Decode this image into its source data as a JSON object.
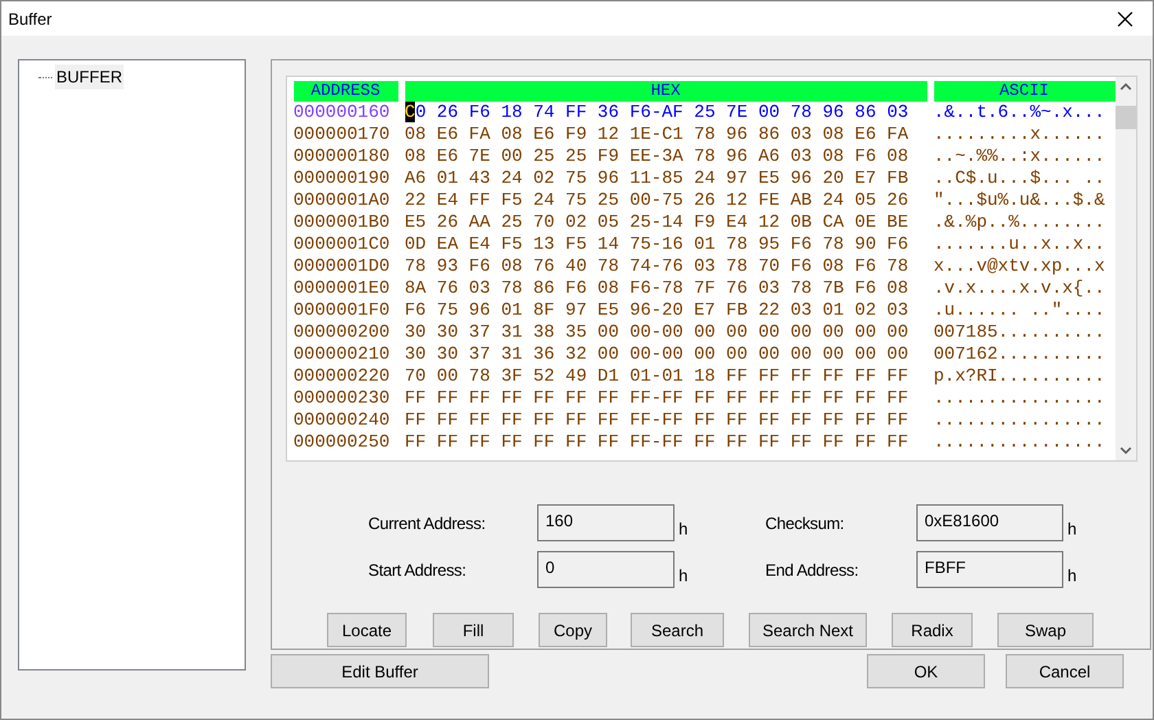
{
  "window": {
    "title": "Buffer"
  },
  "tree": {
    "items": [
      {
        "label": "BUFFER",
        "selected": true
      }
    ]
  },
  "hex_view": {
    "columns": [
      "ADDRESS",
      "HEX",
      "ASCII"
    ],
    "rows": [
      {
        "address": "000000160",
        "hex": "C0 26 F6 18 74 FF 36 F6-AF 25 7E 00 78 96 86 03",
        "ascii": ".&..t.6..%~.x...",
        "selected": true
      },
      {
        "address": "000000170",
        "hex": "08 E6 FA 08 E6 F9 12 1E-C1 78 96 86 03 08 E6 FA",
        "ascii": ".........x......",
        "selected": false
      },
      {
        "address": "000000180",
        "hex": "08 E6 7E 00 25 25 F9 EE-3A 78 96 A6 03 08 F6 08",
        "ascii": "..~.%%..:x......",
        "selected": false
      },
      {
        "address": "000000190",
        "hex": "A6 01 43 24 02 75 96 11-85 24 97 E5 96 20 E7 FB",
        "ascii": "..C$.u...$... ..",
        "selected": false
      },
      {
        "address": "0000001A0",
        "hex": "22 E4 FF F5 24 75 25 00-75 26 12 FE AB 24 05 26",
        "ascii": "\"...$u%.u&...$.&",
        "selected": false
      },
      {
        "address": "0000001B0",
        "hex": "E5 26 AA 25 70 02 05 25-14 F9 E4 12 0B CA 0E BE",
        "ascii": ".&.%p..%........",
        "selected": false
      },
      {
        "address": "0000001C0",
        "hex": "0D EA E4 F5 13 F5 14 75-16 01 78 95 F6 78 90 F6",
        "ascii": ".......u..x..x..",
        "selected": false
      },
      {
        "address": "0000001D0",
        "hex": "78 93 F6 08 76 40 78 74-76 03 78 70 F6 08 F6 78",
        "ascii": "x...v@xtv.xp...x",
        "selected": false
      },
      {
        "address": "0000001E0",
        "hex": "8A 76 03 78 86 F6 08 F6-78 7F 76 03 78 7B F6 08",
        "ascii": ".v.x....x.v.x{..",
        "selected": false
      },
      {
        "address": "0000001F0",
        "hex": "F6 75 96 01 8F 97 E5 96-20 E7 FB 22 03 01 02 03",
        "ascii": ".u...... ..\"....",
        "selected": false
      },
      {
        "address": "000000200",
        "hex": "30 30 37 31 38 35 00 00-00 00 00 00 00 00 00 00",
        "ascii": "007185..........",
        "selected": false
      },
      {
        "address": "000000210",
        "hex": "30 30 37 31 36 32 00 00-00 00 00 00 00 00 00 00",
        "ascii": "007162..........",
        "selected": false
      },
      {
        "address": "000000220",
        "hex": "70 00 78 3F 52 49 D1 01-01 18 FF FF FF FF FF FF",
        "ascii": "p.x?RI..........",
        "selected": false
      },
      {
        "address": "000000230",
        "hex": "FF FF FF FF FF FF FF FF-FF FF FF FF FF FF FF FF",
        "ascii": "................",
        "selected": false
      },
      {
        "address": "000000240",
        "hex": "FF FF FF FF FF FF FF FF-FF FF FF FF FF FF FF FF",
        "ascii": "................",
        "selected": false
      },
      {
        "address": "000000250",
        "hex": "FF FF FF FF FF FF FF FF-FF FF FF FF FF FF FF FF",
        "ascii": "................",
        "selected": false
      }
    ]
  },
  "fields": [
    {
      "label": "Current Address:",
      "value": "160",
      "unit": "h"
    },
    {
      "label": "Checksum:",
      "value": "0xE81600",
      "unit": "h"
    },
    {
      "label": "Start Address:",
      "value": "0",
      "unit": "h"
    },
    {
      "label": "End Address:",
      "value": "FBFF",
      "unit": "h"
    }
  ],
  "actions": [
    "Locate",
    "Fill",
    "Copy",
    "Search",
    "Search Next",
    "Radix",
    "Swap"
  ],
  "footer": {
    "left": "Edit Buffer",
    "right": [
      "OK",
      "Cancel"
    ]
  }
}
